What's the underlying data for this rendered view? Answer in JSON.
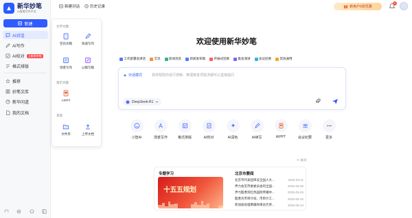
{
  "brand": {
    "name": "新华妙笔",
    "subtitle": "AI智能写作平台"
  },
  "sidebar": {
    "new_label": "新建",
    "items": [
      {
        "label": "AI对话",
        "icon": "chat-icon",
        "active": true
      },
      {
        "label": "AI写作",
        "icon": "pen-icon"
      },
      {
        "label": "AI校对",
        "icon": "check-icon",
        "badge": "上新发布啦"
      },
      {
        "label": "格式排版",
        "icon": "format-icon"
      },
      {
        "label": "推荐",
        "icon": "star-icon"
      },
      {
        "label": "妙笔文库",
        "icon": "library-icon"
      },
      {
        "label": "新华问道",
        "icon": "question-icon"
      },
      {
        "label": "我的文档",
        "icon": "document-icon"
      }
    ]
  },
  "topbar": {
    "new_chat": "新建对话",
    "history": "历史记录",
    "promo": "新用户5折优惠",
    "bell_count": "1"
  },
  "menu": {
    "section_text": "文字文稿",
    "section_ppt": "演示文稿",
    "section_other": "其他",
    "items": {
      "blank": "空白文稿",
      "quick": "快速写作",
      "long": "场景写作",
      "draft": "以稿写稿",
      "ai_ppt": "AIPPT",
      "file": "文件夹",
      "upload": "上传文档"
    }
  },
  "main": {
    "title": "欢迎使用新华妙笔",
    "tools": [
      "工作部署会讲话",
      "交流",
      "新闻消息",
      "新闻发布稿",
      "开展式巡察",
      "集会演讲",
      "会议纪要",
      "其他通用"
    ],
    "mode": "对话模式",
    "placeholder": "我将帮助你进行搜索、推理等各项需求都可以直接提问",
    "model": "DeepSeek-R1"
  },
  "shortcuts": [
    "小智AI",
    "场景写作",
    "格式排版",
    "AI校对",
    "AI润色",
    "AI续写",
    "AIPPT",
    "会议纪要",
    "更多"
  ],
  "cards": {
    "close_label": "关闭",
    "study_title": "专题学习",
    "banner_text": "十五五规划",
    "news_title": "北京市要闻",
    "news": [
      {
        "title": "北京市代表团审议全国人大...",
        "date": "2025-03-11"
      },
      {
        "title": "尹力会见市委委员会的全国...",
        "date": "2025-06-25"
      },
      {
        "title": "尹力殷勇到红色国际传播中...",
        "date": "2025-06-25"
      },
      {
        "title": "殷勇为市审计局、市审计工...",
        "date": "2025-06-25"
      },
      {
        "title": "新加坡总理黄循财来访元荣...",
        "date": "2025-06-24"
      }
    ]
  }
}
